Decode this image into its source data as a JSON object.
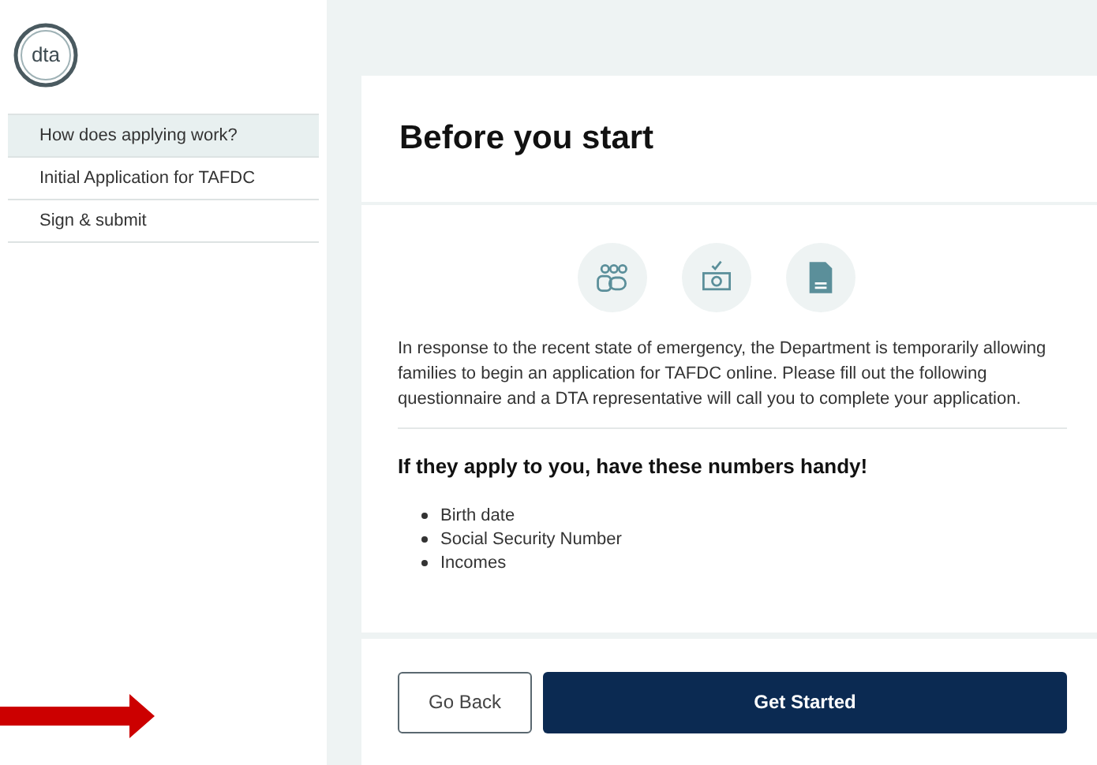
{
  "logo": {
    "text": "dta"
  },
  "sidebar": {
    "items": [
      {
        "label": "How does applying work?",
        "selected": true
      },
      {
        "label": "Initial Application for TAFDC",
        "selected": false
      },
      {
        "label": "Sign & submit",
        "selected": false
      }
    ]
  },
  "card": {
    "title": "Before you start",
    "icons": [
      {
        "kind": "people"
      },
      {
        "kind": "money"
      },
      {
        "kind": "document"
      }
    ],
    "intro": "In response to the recent state of emergency, the Department is temporarily allowing families to begin an application for TAFDC online. Please fill out the following questionnaire and a DTA representative will call you to complete your application.",
    "checklist_title": "If they apply to you, have these numbers handy!",
    "checklist": [
      "Birth date",
      "Social Security Number",
      "Incomes"
    ],
    "buttons": [
      {
        "label": "Go Back",
        "kind": "secondary"
      },
      {
        "label": "Get Started",
        "kind": "primary"
      }
    ]
  }
}
